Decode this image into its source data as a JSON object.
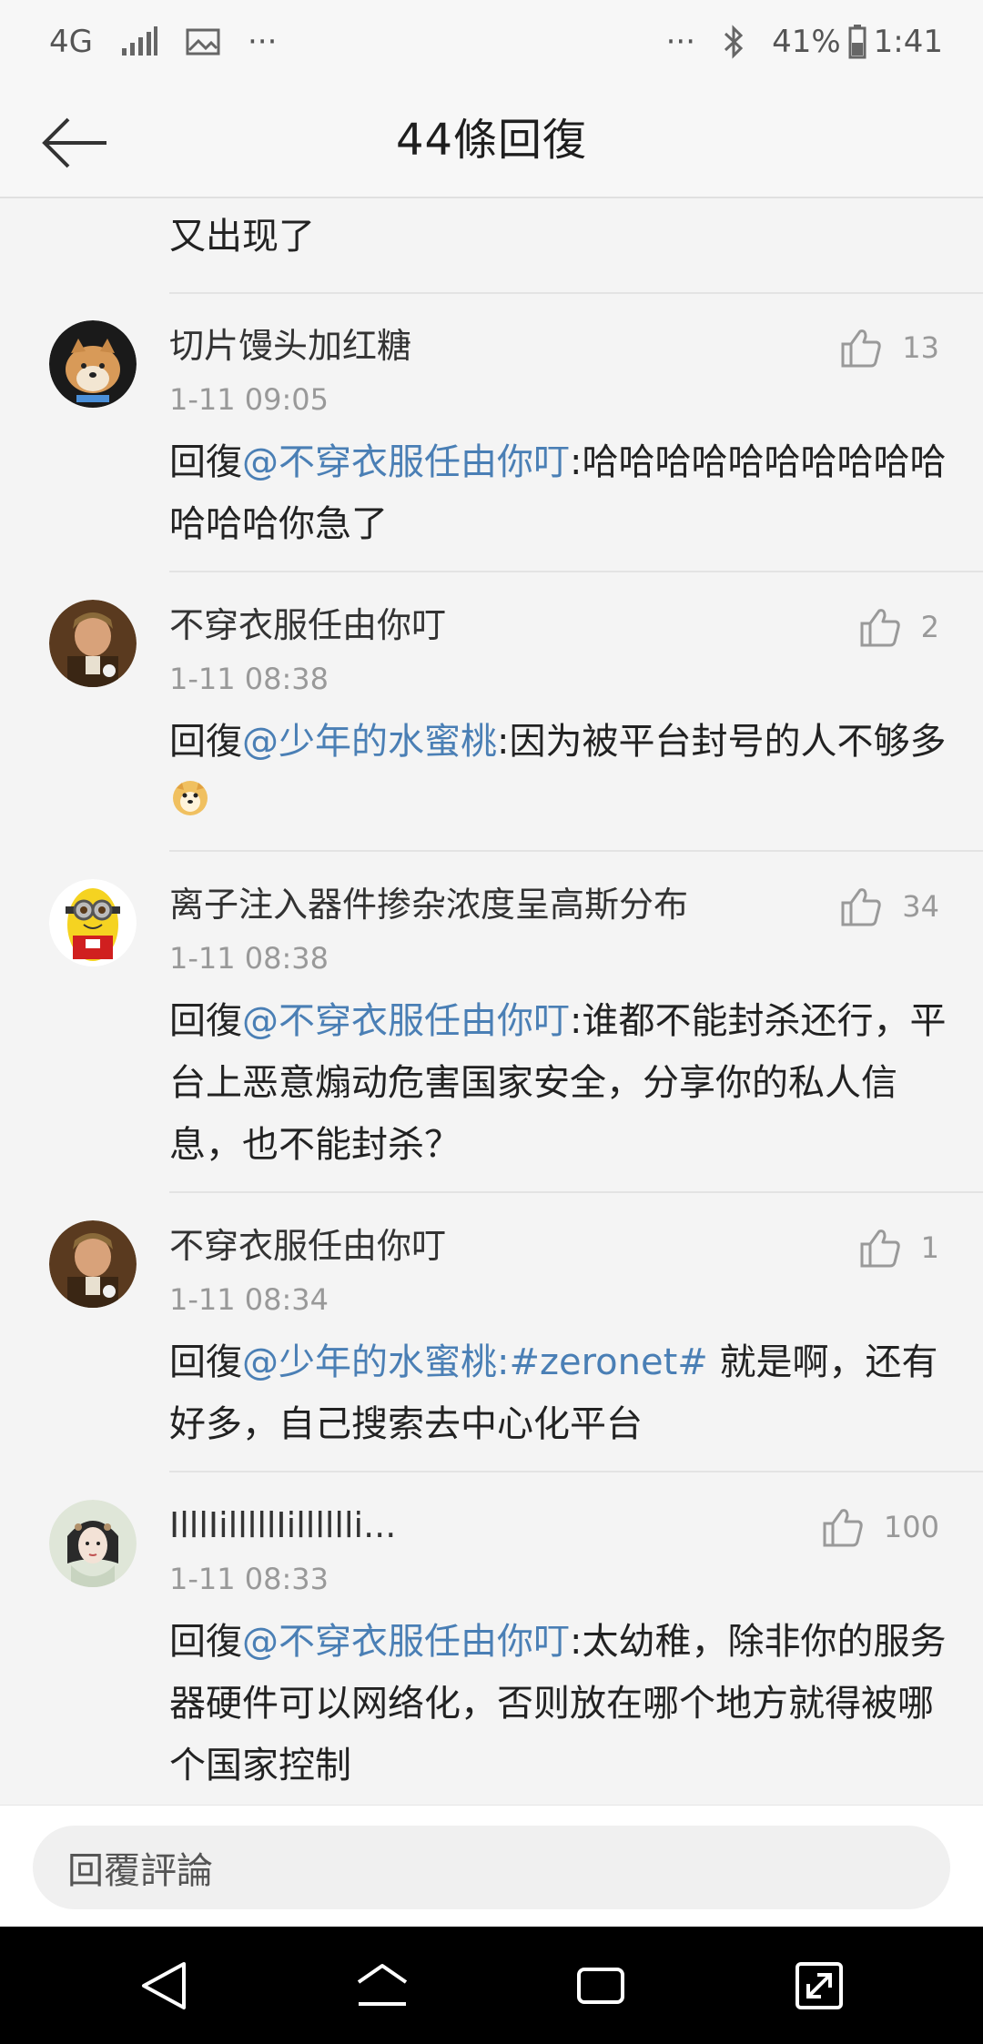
{
  "status_bar": {
    "network": "4G",
    "dots_left": "···",
    "dots_right": "···",
    "battery": "41%",
    "time": "1:41"
  },
  "header": {
    "title": "44條回復"
  },
  "top_partial": {
    "second_line": "又出现了"
  },
  "comments": [
    {
      "username": "切片馒头加红糖",
      "time": "1-11 09:05",
      "likes": "13",
      "reply_prefix": "回復",
      "mention": "@不穿衣服任由你叮",
      "text": ":哈哈哈哈哈哈哈哈哈哈哈哈哈你急了"
    },
    {
      "username": "不穿衣服任由你叮",
      "time": "1-11 08:38",
      "likes": "2",
      "reply_prefix": "回復",
      "mention": "@少年的水蜜桃",
      "text": ":因为被平台封号的人不够多"
    },
    {
      "username": "离子注入器件掺杂浓度呈高斯分布",
      "time": "1-11 08:38",
      "likes": "34",
      "reply_prefix": "回復",
      "mention": "@不穿衣服任由你叮",
      "text": ":谁都不能封杀还行，平台上恶意煽动危害国家安全，分享你的私人信息，也不能封杀？"
    },
    {
      "username": "不穿衣服任由你叮",
      "time": "1-11 08:34",
      "likes": "1",
      "reply_prefix": "回復",
      "mention": "@少年的水蜜桃",
      "hashtag": ":#zeronet#",
      "text": " 就是啊，还有好多，自己搜索去中心化平台"
    },
    {
      "username": "IlllIilllllIilllllli...",
      "time": "1-11 08:33",
      "likes": "100",
      "reply_prefix": "回復",
      "mention": "@不穿衣服任由你叮",
      "text": ":太幼稚，除非你的服务器硬件可以网络化，否则放在哪个地方就得被哪个国家控制"
    }
  ],
  "reply_bar": {
    "placeholder": "回覆評論"
  },
  "colors": {
    "mention": "#4a7fb5",
    "background": "#f4f4f4"
  }
}
